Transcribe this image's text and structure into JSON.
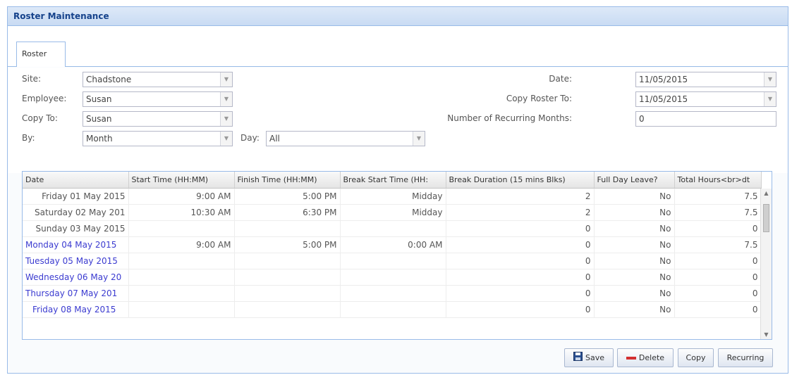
{
  "panel": {
    "title": "Roster Maintenance"
  },
  "tabs": [
    {
      "label": "Roster"
    }
  ],
  "form": {
    "site": {
      "label": "Site:",
      "value": "Chadstone"
    },
    "employee": {
      "label": "Employee:",
      "value": "Susan"
    },
    "copy_to": {
      "label": "Copy To:",
      "value": "Susan"
    },
    "by": {
      "label": "By:",
      "value": "Month"
    },
    "day": {
      "label": "Day:",
      "value": "All"
    },
    "date": {
      "label": "Date:",
      "value": "11/05/2015"
    },
    "copy_roster_to": {
      "label": "Copy Roster To:",
      "value": "11/05/2015"
    },
    "recurring_months": {
      "label": "Number of Recurring Months:",
      "value": "0"
    }
  },
  "grid": {
    "columns": [
      "Date",
      "Start Time (HH:MM)",
      "Finish Time (HH:MM)",
      "Break Start Time (HH:",
      "Break Duration (15 mins Blks)",
      "Full Day Leave?",
      "Total Hours<br>dt"
    ],
    "rows": [
      [
        "Friday 01 May 2015",
        "9:00 AM",
        "5:00 PM",
        "Midday",
        "2",
        "No",
        "7.5"
      ],
      [
        "Saturday 02 May 201",
        "10:30 AM",
        "6:30 PM",
        "Midday",
        "2",
        "No",
        "7.5"
      ],
      [
        "Sunday 03 May 2015",
        "",
        "",
        "",
        "0",
        "No",
        "0"
      ],
      [
        "Monday 04 May 2015",
        "9:00 AM",
        "5:00 PM",
        "0:00 AM",
        "0",
        "No",
        "7.5"
      ],
      [
        "Tuesday 05 May 2015",
        "",
        "",
        "",
        "0",
        "No",
        "0"
      ],
      [
        "Wednesday 06 May 20",
        "",
        "",
        "",
        "0",
        "No",
        "0"
      ],
      [
        "Thursday 07 May 201",
        "",
        "",
        "",
        "0",
        "No",
        "0"
      ],
      [
        "Friday 08 May 2015",
        "",
        "",
        "",
        "0",
        "No",
        "0"
      ]
    ]
  },
  "buttons": {
    "save": "Save",
    "delete": "Delete",
    "copy": "Copy",
    "recurring": "Recurring"
  },
  "colors": {
    "header_text": "#15428b",
    "weekday_link": "#3b3bd0",
    "border": "#99bbe8"
  }
}
